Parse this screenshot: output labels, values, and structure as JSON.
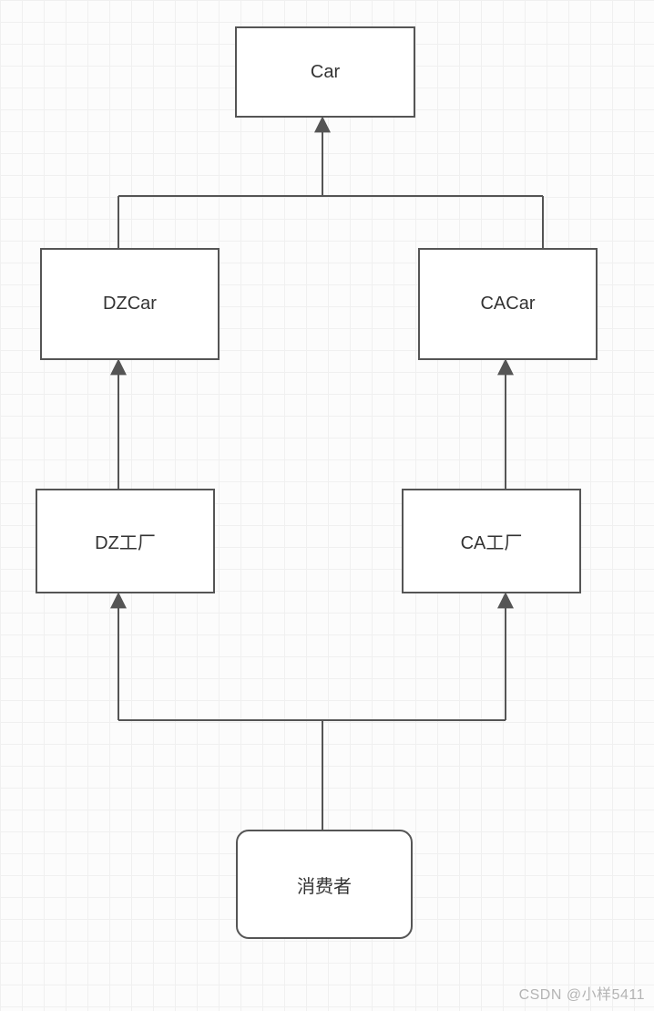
{
  "nodes": {
    "car": "Car",
    "dzcar": "DZCar",
    "cacar": "CACar",
    "dzfactory": "DZ工厂",
    "cafactory": "CA工厂",
    "consumer": "消费者"
  },
  "watermark": "CSDN @小样5411"
}
